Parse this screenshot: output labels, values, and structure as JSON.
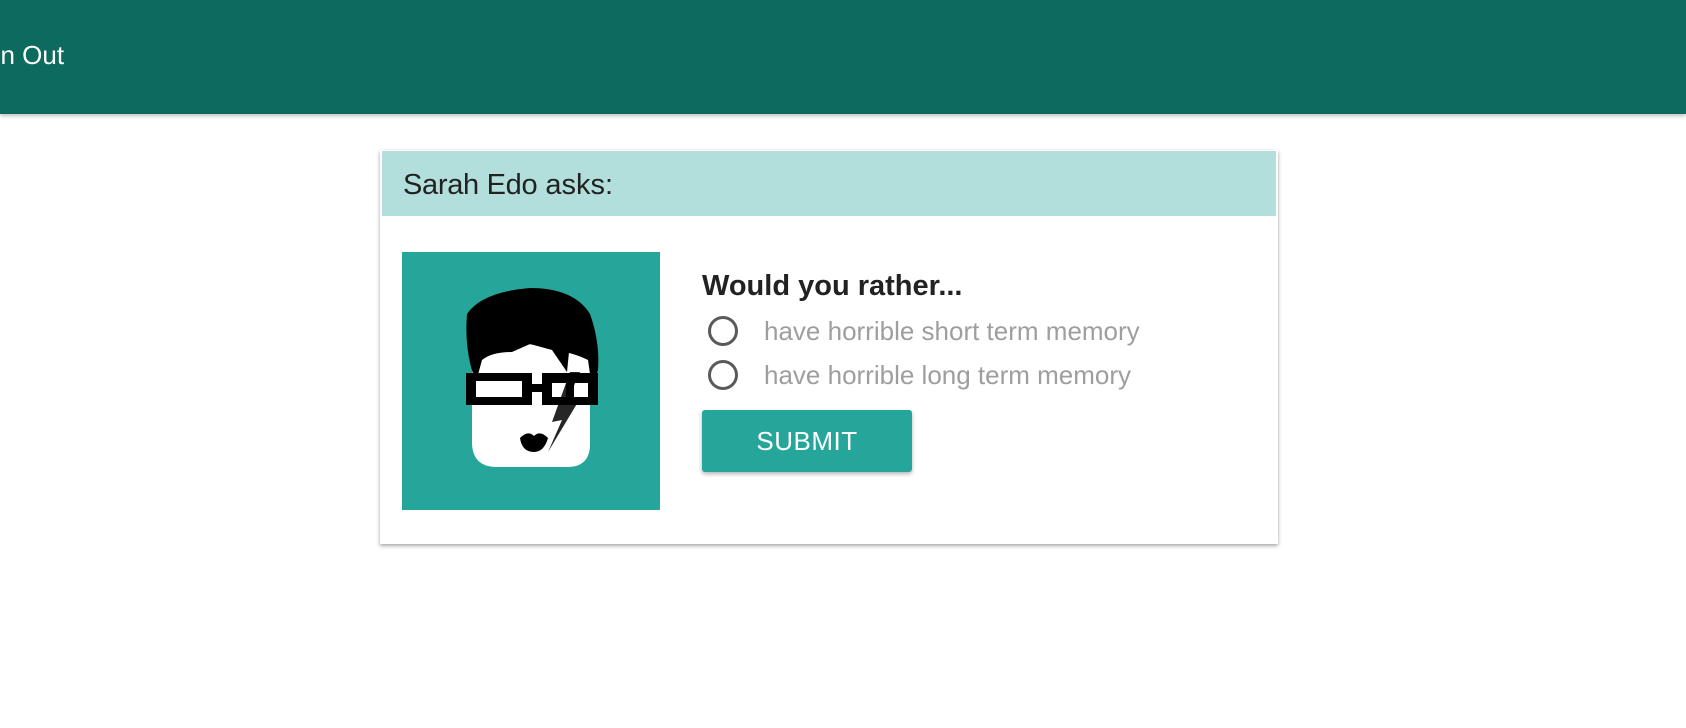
{
  "topbar": {
    "signout_label": "gn Out",
    "background_color": "#0c6b5e"
  },
  "card": {
    "header": {
      "author": "Sarah Edo",
      "asks_suffix": " asks:",
      "background_color": "#b2dfdb"
    },
    "avatar": {
      "icon": "avatar-cartoon-face",
      "background_color": "#26a69a"
    },
    "question": {
      "title": "Would you rather...",
      "options": [
        {
          "label": "have horrible short term memory",
          "selected": false
        },
        {
          "label": "have horrible long term memory",
          "selected": false
        }
      ]
    },
    "submit_label": "SUBMIT"
  }
}
